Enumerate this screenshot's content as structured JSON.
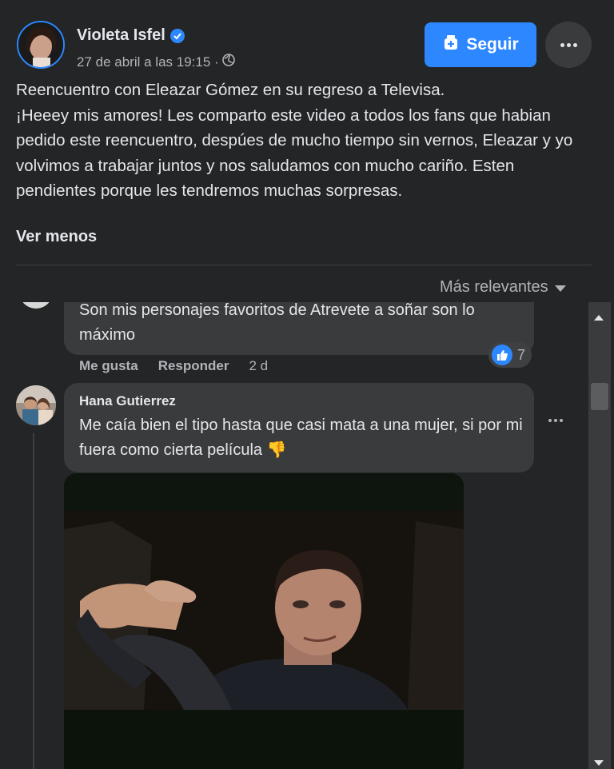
{
  "post": {
    "author": "Violeta Isfel",
    "timestamp": "27 de abril a las 19:15 ·",
    "audience_icon": "globe-icon",
    "verified_icon": "verified-badge-icon",
    "follow_label": "Seguir",
    "body": "Reencuentro con Eleazar Gómez en su regreso a Televisa.\n¡Heeey mis amores! Les comparto este video a todos los fans que habian pedido este reencuentro, despúes de mucho tiempo sin vernos, Eleazar y yo volvimos a trabajar juntos y nos saludamos con mucho cariño. Esten pendientes porque les tendremos muchas sorpresas.",
    "see_less": "Ver menos"
  },
  "comments_header": {
    "sort_label": "Más relevantes"
  },
  "comments": [
    {
      "text": "Son mis personajes favoritos de Atrevete a soñar son lo máximo",
      "reaction_count": "7",
      "like_label": "Me gusta",
      "reply_label": "Responder",
      "time": "2 d"
    },
    {
      "author": "Hana Gutierrez",
      "text": "Me caía bien el tipo hasta que casi mata a una mujer, si por mi fuera como cierta película 👎",
      "attachment": "gif"
    }
  ],
  "colors": {
    "background": "#242526",
    "bubble": "#3a3b3c",
    "accent": "#2d88ff",
    "text_primary": "#e4e6eb",
    "text_secondary": "#b0b3b8"
  }
}
